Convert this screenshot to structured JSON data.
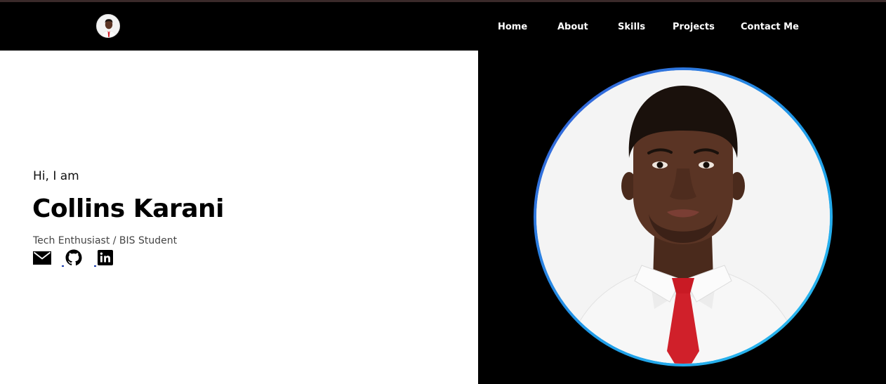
{
  "nav": {
    "links": [
      {
        "label": "Home"
      },
      {
        "label": "About"
      },
      {
        "label": "Skills"
      },
      {
        "label": "Projects"
      },
      {
        "label": "Contact Me"
      }
    ]
  },
  "hero": {
    "greeting": "Hi, I am",
    "name": "Collins Karani",
    "tagline": "Tech Enthusiast / BIS Student",
    "social": [
      {
        "icon": "mail-icon"
      },
      {
        "icon": "github-icon"
      },
      {
        "icon": "linkedin-icon"
      }
    ]
  },
  "colors": {
    "background_dark": "#000000",
    "background_light": "#ffffff",
    "ring_start": "#3a59d6",
    "ring_end": "#2cc0f0",
    "tie": "#d0202a"
  }
}
